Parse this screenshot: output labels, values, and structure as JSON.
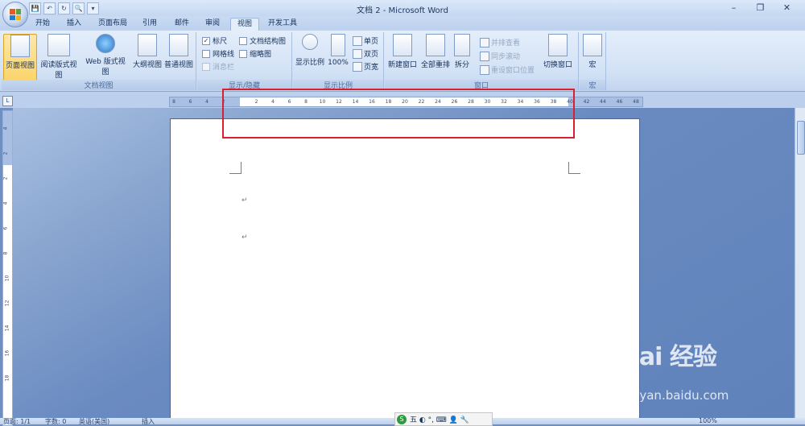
{
  "window": {
    "title": "文档 2 - Microsoft Word",
    "controls": [
      "–",
      "❐",
      "✕"
    ]
  },
  "qat": {
    "items": [
      "💾",
      "↶",
      "↻",
      "🔍",
      "▾"
    ]
  },
  "tabs": [
    {
      "label": "开始",
      "active": false
    },
    {
      "label": "插入",
      "active": false
    },
    {
      "label": "页面布局",
      "active": false
    },
    {
      "label": "引用",
      "active": false
    },
    {
      "label": "邮件",
      "active": false
    },
    {
      "label": "审阅",
      "active": false
    },
    {
      "label": "视图",
      "active": true
    },
    {
      "label": "开发工具",
      "active": false
    }
  ],
  "ribbon": {
    "doc_views": {
      "label": "文档视图",
      "buttons": [
        "页面视图",
        "阅读版式视图",
        "Web 版式视图",
        "大纲视图",
        "普通视图"
      ]
    },
    "show_hide": {
      "label": "显示/隐藏",
      "ruler": "标尺",
      "gridlines": "网格线",
      "message_bar": "消息栏",
      "doc_map": "文档结构图",
      "thumbnails": "缩略图"
    },
    "zoom": {
      "label": "显示比例",
      "zoom_button": "显示比例",
      "hundred": "100%",
      "one_page": "单页",
      "two_pages": "双页",
      "page_width": "页宽"
    },
    "window": {
      "label": "窗口",
      "new_window": "新建窗口",
      "arrange_all": "全部重排",
      "split": "拆分",
      "side_by_side": "并排查看",
      "sync_scroll": "同步滚动",
      "reset_pos": "重设窗口位置",
      "switch": "切换窗口"
    },
    "macros": {
      "label": "宏",
      "button": "宏"
    }
  },
  "ruler": {
    "left_labels": [
      "8",
      "6",
      "4",
      "2"
    ],
    "main_labels": [
      "2",
      "4",
      "6",
      "8",
      "10",
      "12",
      "14",
      "16",
      "18",
      "20",
      "22",
      "24",
      "26",
      "28",
      "30",
      "32",
      "34",
      "36",
      "38"
    ],
    "right_labels": [
      "40",
      "42",
      "44",
      "46",
      "48"
    ],
    "vertical_labels": [
      "4",
      "2",
      "2",
      "4",
      "6",
      "8",
      "10",
      "12",
      "14",
      "16",
      "18"
    ]
  },
  "document": {
    "para_mark_1": "↵",
    "para_mark_2": "↵"
  },
  "status": {
    "page": "页面: 1/1",
    "words": "字数: 0",
    "lang": "英语(美国)",
    "mode": "插入",
    "zoom": "100%"
  },
  "ime": {
    "logo": "S",
    "text": "五 ◐ °, ⌨ 👤 🔧"
  },
  "watermark": {
    "text": "Bai 经验",
    "url": "jingyan.baidu.com"
  },
  "colors": {
    "highlight": "#d8202f",
    "accent": "#2a5699"
  }
}
